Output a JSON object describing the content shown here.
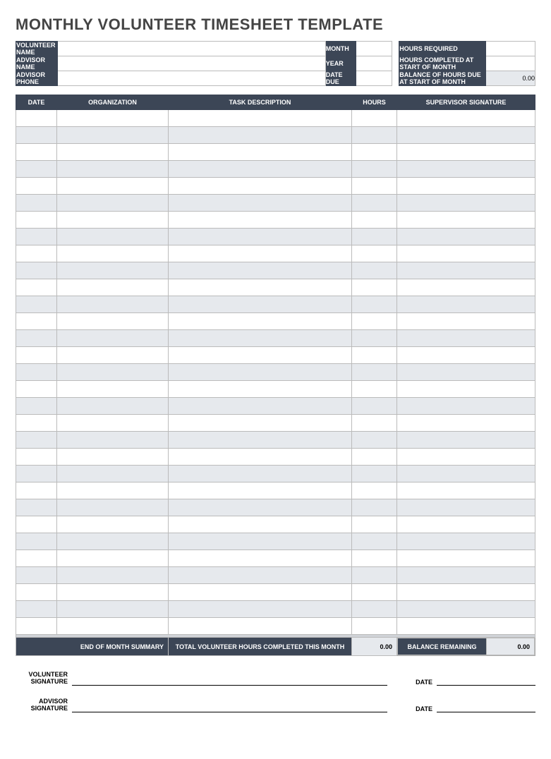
{
  "title": "MONTHLY VOLUNTEER TIMESHEET TEMPLATE",
  "header": {
    "volunteer_name_label": "VOLUNTEER NAME",
    "advisor_name_label": "ADVISOR NAME",
    "advisor_phone_label": "ADVISOR PHONE",
    "month_label": "MONTH",
    "year_label": "YEAR",
    "date_due_label": "DATE DUE",
    "hours_required_label": "HOURS REQUIRED",
    "hours_completed_label": "HOURS COMPLETED AT START OF MONTH",
    "balance_due_label": "BALANCE OF HOURS DUE AT START OF MONTH",
    "volunteer_name": "",
    "advisor_name": "",
    "advisor_phone": "",
    "month": "",
    "year": "",
    "date_due": "",
    "hours_required": "",
    "hours_completed": "",
    "balance_due": "0.00"
  },
  "columns": {
    "date": "DATE",
    "organization": "ORGANIZATION",
    "task": "TASK DESCRIPTION",
    "hours": "HOURS",
    "signature": "SUPERVISOR SIGNATURE"
  },
  "rows": 31,
  "summary": {
    "end_label": "END OF MONTH SUMMARY",
    "total_label": "TOTAL VOLUNTEER HOURS COMPLETED THIS MONTH",
    "total_value": "0.00",
    "balance_label": "BALANCE REMAINING",
    "balance_value": "0.00"
  },
  "sig": {
    "volunteer": "VOLUNTEER SIGNATURE",
    "advisor": "ADVISOR SIGNATURE",
    "date": "DATE"
  }
}
